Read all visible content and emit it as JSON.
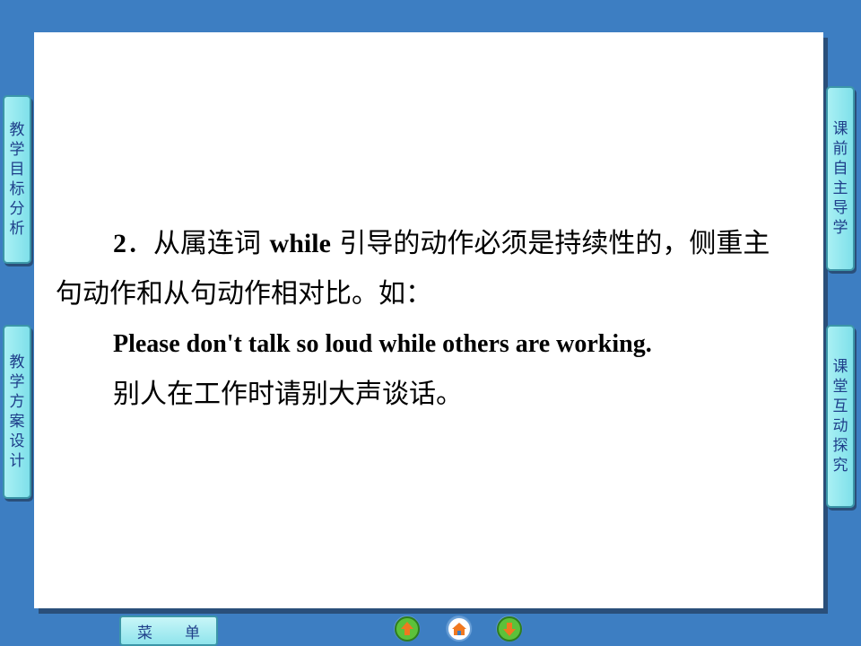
{
  "slide": {
    "number": "2",
    "line1_pre": "．从属连词 ",
    "line1_kw": "while",
    "line1_post": " 引导的动作必须是持续性的，侧重主",
    "line2": "句动作和从句动作相对比。如：",
    "example_en": "Please don't talk so loud while others are working.",
    "example_zh": "别人在工作时请别大声谈话。"
  },
  "left_tabs": [
    {
      "chars": [
        "教",
        "学",
        "目",
        "标",
        "分",
        "析"
      ]
    },
    {
      "chars": [
        "教",
        "学",
        "方",
        "案",
        "设",
        "计"
      ]
    }
  ],
  "right_tabs": [
    {
      "chars": [
        "课",
        "前",
        "自",
        "主",
        "导",
        "学"
      ]
    },
    {
      "chars": [
        "课",
        "堂",
        "互",
        "动",
        "探",
        "究"
      ]
    }
  ],
  "bottom_bar": {
    "menu_char1": "菜",
    "menu_char2": "单"
  },
  "colors": {
    "background": "#3d7ec2",
    "tab": "#8fe4ec",
    "tab_text": "#1f3f8a",
    "nav_orange": "#f07820",
    "nav_green": "#5cc13a"
  },
  "icons": [
    "previous-arrow-icon",
    "home-icon",
    "next-arrow-icon"
  ]
}
